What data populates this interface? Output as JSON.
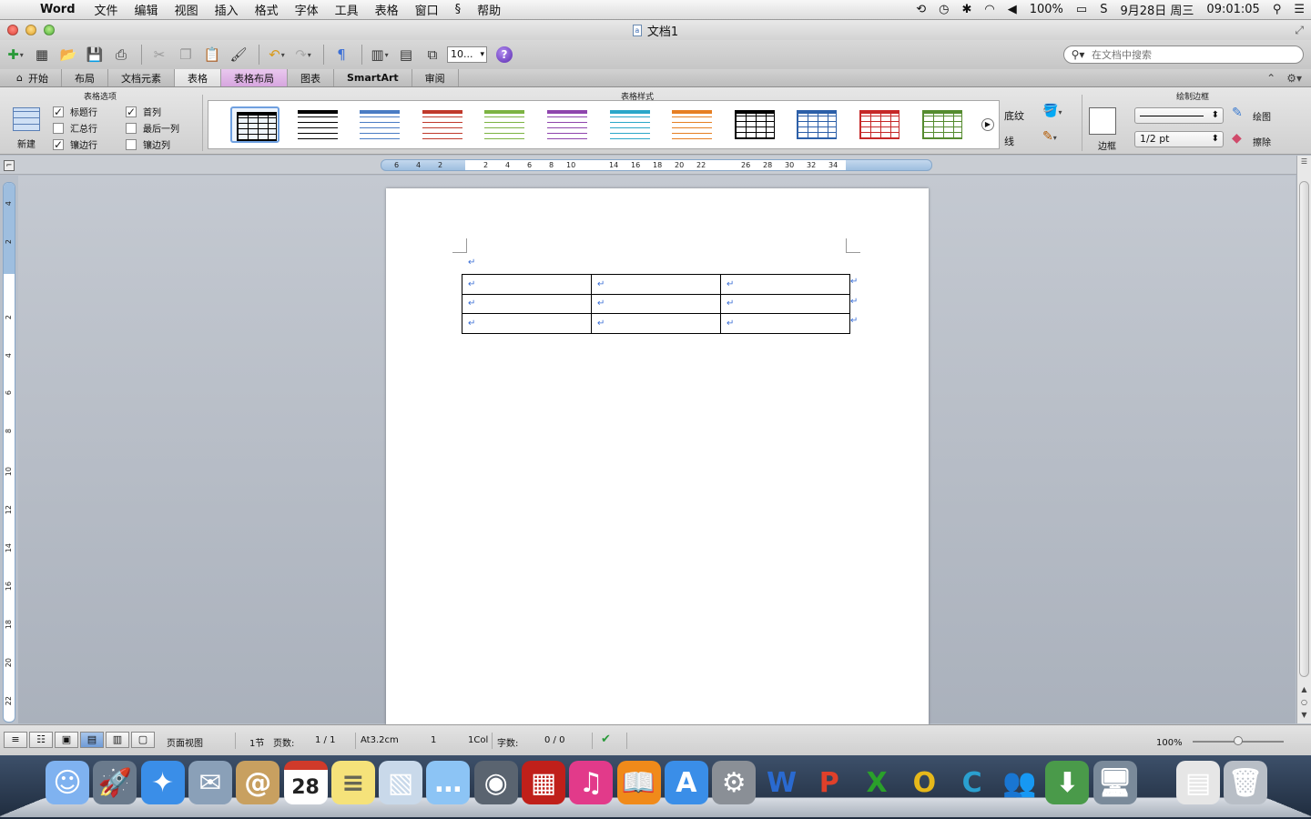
{
  "menubar": {
    "app_name": "Word",
    "menus": [
      "文件",
      "编辑",
      "视图",
      "插入",
      "格式",
      "字体",
      "工具",
      "表格",
      "窗口",
      "帮助"
    ],
    "battery": "100%",
    "date": "9月28日 周三",
    "time": "09:01:05"
  },
  "window": {
    "title": "文档1"
  },
  "toolbar": {
    "zoom_value": "10...",
    "search_placeholder": "在文档中搜索"
  },
  "tabs": [
    "开始",
    "布局",
    "文档元素",
    "表格",
    "表格布局",
    "图表",
    "SmartArt",
    "审阅"
  ],
  "ribbon": {
    "table_options": {
      "title": "表格选项",
      "new_label": "新建",
      "options": [
        {
          "label": "标题行",
          "checked": true
        },
        {
          "label": "汇总行",
          "checked": false
        },
        {
          "label": "镶边行",
          "checked": true
        },
        {
          "label": "首列",
          "checked": true
        },
        {
          "label": "最后一列",
          "checked": false
        },
        {
          "label": "镶边列",
          "checked": false
        }
      ]
    },
    "table_styles": {
      "title": "表格样式",
      "colors": [
        "#000000",
        "#000000",
        "#4a7cc4",
        "#c0392b",
        "#7cb342",
        "#8e44ad",
        "#2aa7c9",
        "#e67e22",
        "#000000",
        "#2c5fa8",
        "#c62828",
        "#558b2f"
      ],
      "shading_label": "底纹",
      "line_label": "线"
    },
    "draw_borders": {
      "title": "绘制边框",
      "border_label": "边框",
      "line_weight": "1/2 pt",
      "draw_label": "绘图",
      "erase_label": "擦除"
    }
  },
  "ruler": {
    "numbers": [
      "6",
      "4",
      "2",
      "2",
      "4",
      "6",
      "8",
      "10",
      "14",
      "16",
      "18",
      "20",
      "22",
      "26",
      "28",
      "30",
      "32",
      "34"
    ],
    "vertical_numbers": [
      "4",
      "2",
      "2",
      "4",
      "6",
      "8",
      "10",
      "12",
      "14",
      "16",
      "18",
      "20",
      "22"
    ]
  },
  "document": {
    "para_mark": "↵",
    "table": {
      "rows": 3,
      "cols": 3
    }
  },
  "statusbar": {
    "view_name": "页面视图",
    "section": "1节",
    "pages_label": "页数:",
    "pages_value": "1 / 1",
    "position": "At3.2cm",
    "line": "1",
    "column": "1Col",
    "words_label": "字数:",
    "words_value": "0 / 0",
    "zoom": "100%"
  },
  "dock": {
    "apps": [
      "finder-icon",
      "launchpad-icon",
      "safari-icon",
      "mail-icon",
      "contacts-icon",
      "calendar-icon",
      "notes-icon",
      "preview-icon",
      "messages-icon",
      "facetime-icon",
      "photobooth-icon",
      "itunes-icon",
      "ibooks-icon",
      "appstore-icon",
      "system-preferences-icon",
      "word-icon",
      "powerpoint-icon",
      "excel-icon",
      "outlook-icon",
      "communicator-icon",
      "messenger-icon",
      "download-icon",
      "remote-desktop-icon",
      "documents-icon",
      "trash-icon"
    ],
    "calendar_day": "28"
  }
}
